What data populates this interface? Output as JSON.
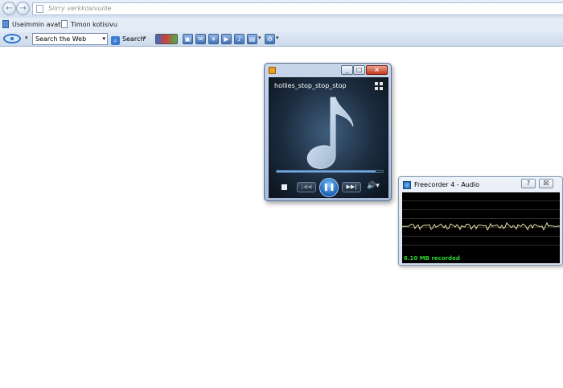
{
  "browser": {
    "address_placeholder": "Siirry verkkosivuille",
    "back_glyph": "←",
    "forward_glyph": "→"
  },
  "bookmarks": [
    {
      "label": "Useimmin avatut",
      "icon": "bookmark-star-icon"
    },
    {
      "label": "Timon kotisivu",
      "icon": "page-icon"
    }
  ],
  "toolbar": {
    "search_placeholder": "Search the Web",
    "search_label": "Search",
    "icons": [
      "logo-icon",
      "news-icon",
      "photo-icon",
      "mail-icon",
      "weather-icon",
      "radio-icon",
      "music-icon",
      "videos-icon",
      "games-icon",
      "options-icon"
    ]
  },
  "media_player": {
    "track_title": "hollies_stop_stop_stop",
    "progress": 0.93,
    "colors": {
      "accent": "#3d86d6"
    }
  },
  "recorder": {
    "title": "Freecorder 4 - Audio",
    "help_label": "?",
    "close_label": "☒",
    "status": "6.10 MB recorded",
    "colors": {
      "status": "#2fd52f",
      "wave": "#e8e6a0"
    }
  }
}
